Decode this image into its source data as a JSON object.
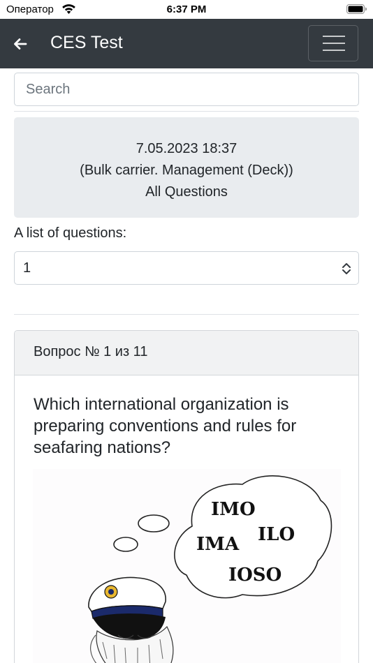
{
  "status_bar": {
    "carrier": "Оператор",
    "time": "6:37 PM"
  },
  "navbar": {
    "title": "CES Test"
  },
  "search": {
    "placeholder": "Search"
  },
  "info": {
    "date": "7.05.2023 18:37",
    "category": "(Bulk carrier. Management (Deck))",
    "mode": "All Questions"
  },
  "question_list": {
    "label": "A list of questions:",
    "selected": "1"
  },
  "question_card": {
    "header": "Вопрос № 1 из 11",
    "text": "Which international organization is preparing conventions and rules for seafaring nations?",
    "image_words": [
      "IMO",
      "ILO",
      "IMA",
      "IOSO"
    ]
  },
  "colors": {
    "navbar": "#343a40",
    "info_bg": "#e9ecef",
    "card_header_bg": "#f1f2f3",
    "border": "#ced4da"
  },
  "icons": [
    "wifi-icon",
    "battery-icon",
    "back-arrow-icon",
    "menu-icon",
    "chevron-updown-icon"
  ]
}
